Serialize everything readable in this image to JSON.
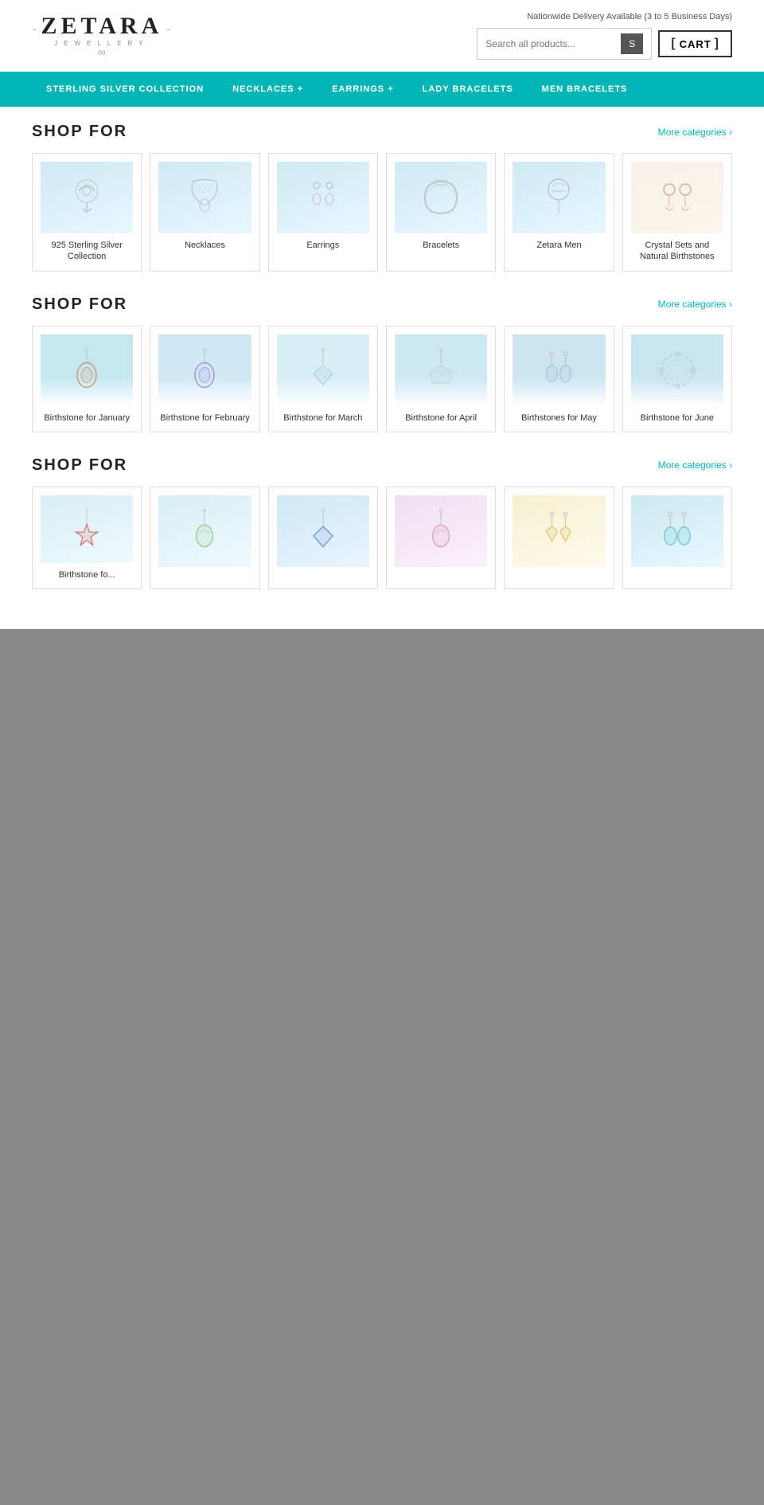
{
  "header": {
    "logo": {
      "name": "ZETARA",
      "subtitle": "JEWELLERY",
      "ornament": "~∞~"
    },
    "delivery_text": "Nationwide Delivery Available (3 to 5 Business Days)",
    "search": {
      "placeholder": "Search all products...",
      "button_label": "S"
    },
    "cart_label": "CART"
  },
  "nav": {
    "items": [
      {
        "label": "STERLING SILVER COLLECTION"
      },
      {
        "label": "NECKLACES +"
      },
      {
        "label": "EARRINGS +"
      },
      {
        "label": "LADY BRACELETS"
      },
      {
        "label": "MEN BRACELETS"
      }
    ]
  },
  "sections": [
    {
      "title": "SHOP FOR",
      "more_label": "More categories ›",
      "categories": [
        {
          "label": "925 Sterling Silver Collection",
          "img_type": "sterling"
        },
        {
          "label": "Necklaces",
          "img_type": "necklace"
        },
        {
          "label": "Earrings",
          "img_type": "earrings"
        },
        {
          "label": "Bracelets",
          "img_type": "bracelet"
        },
        {
          "label": "Zetara Men",
          "img_type": "men"
        },
        {
          "label": "Crystal Sets and Natural Birthstones",
          "img_type": "crystal"
        }
      ]
    },
    {
      "title": "SHOP FOR",
      "more_label": "More categories ›",
      "categories": [
        {
          "label": "Birthstone for January",
          "img_type": "jan"
        },
        {
          "label": "Birthstone for February",
          "img_type": "feb"
        },
        {
          "label": "Birthstone for March",
          "img_type": "mar"
        },
        {
          "label": "Birthstone for April",
          "img_type": "apr"
        },
        {
          "label": "Birthstones for May",
          "img_type": "may"
        },
        {
          "label": "Birthstone for June",
          "img_type": "jun"
        }
      ]
    },
    {
      "title": "SHOP FOR",
      "more_label": "More categories ›",
      "categories": [
        {
          "label": "Birthstone fo...",
          "img_type": "jul",
          "partial": true
        },
        {
          "label": "",
          "img_type": "aug"
        },
        {
          "label": "",
          "img_type": "sep"
        },
        {
          "label": "",
          "img_type": "oct"
        },
        {
          "label": "",
          "img_type": "nov"
        },
        {
          "label": "",
          "img_type": "dec"
        }
      ]
    }
  ]
}
